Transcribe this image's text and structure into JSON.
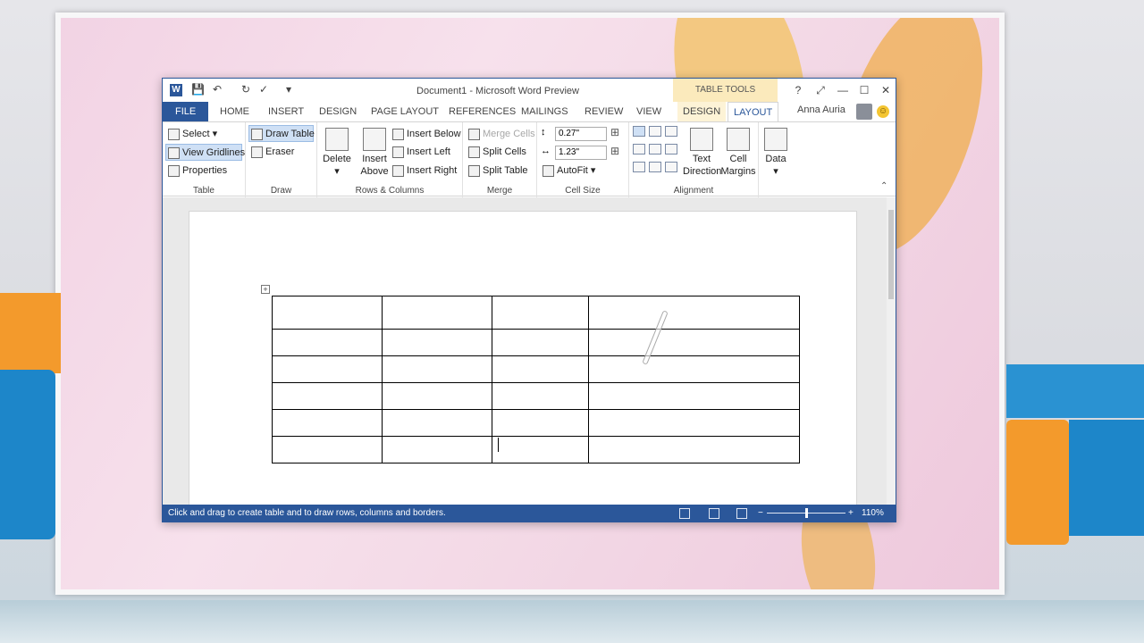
{
  "window": {
    "doc_title": "Document1 - Microsoft Word Preview",
    "contextual_tab_group": "TABLE TOOLS",
    "user_name": "Anna Auria",
    "controls": {
      "help": "?",
      "restore_ribbon": "⤢",
      "minimize": "—",
      "maximize": "☐",
      "close": "✕"
    },
    "app_icon": "W"
  },
  "quick_access": {
    "save_icon": "💾",
    "undo_icon": "↶",
    "redo_icon": "↻",
    "spelling_icon": "✓",
    "customize": "▾"
  },
  "tabs": [
    "FILE",
    "HOME",
    "INSERT",
    "DESIGN",
    "PAGE LAYOUT",
    "REFERENCES",
    "MAILINGS",
    "REVIEW",
    "VIEW",
    "DESIGN",
    "LAYOUT"
  ],
  "ribbon": {
    "table": {
      "label": "Table",
      "select": "Select",
      "view_gridlines": "View Gridlines",
      "properties": "Properties"
    },
    "draw": {
      "label": "Draw",
      "draw_table": "Draw Table",
      "eraser": "Eraser"
    },
    "rows_columns": {
      "label": "Rows & Columns",
      "delete": "Delete",
      "insert_above_1": "Insert",
      "insert_above_2": "Above",
      "insert_below": "Insert Below",
      "insert_left": "Insert Left",
      "insert_right": "Insert Right"
    },
    "merge": {
      "label": "Merge",
      "merge_cells": "Merge Cells",
      "split_cells": "Split Cells",
      "split_table": "Split Table"
    },
    "cell_size": {
      "label": "Cell Size",
      "height": "0.27\"",
      "width": "1.23\"",
      "autofit": "AutoFit"
    },
    "alignment": {
      "label": "Alignment",
      "text_direction_1": "Text",
      "text_direction_2": "Direction",
      "cell_margins_1": "Cell",
      "cell_margins_2": "Margins"
    },
    "data": {
      "label": "Data"
    }
  },
  "document": {
    "table_rows": 6,
    "table_cols": 4
  },
  "status": {
    "hint": "Click and drag to create table and to draw rows, columns and borders.",
    "zoom": "110%",
    "zoom_out": "−",
    "zoom_in": "+"
  },
  "colors": {
    "accent": "#2b579a",
    "contextual": "#fbeabc"
  }
}
